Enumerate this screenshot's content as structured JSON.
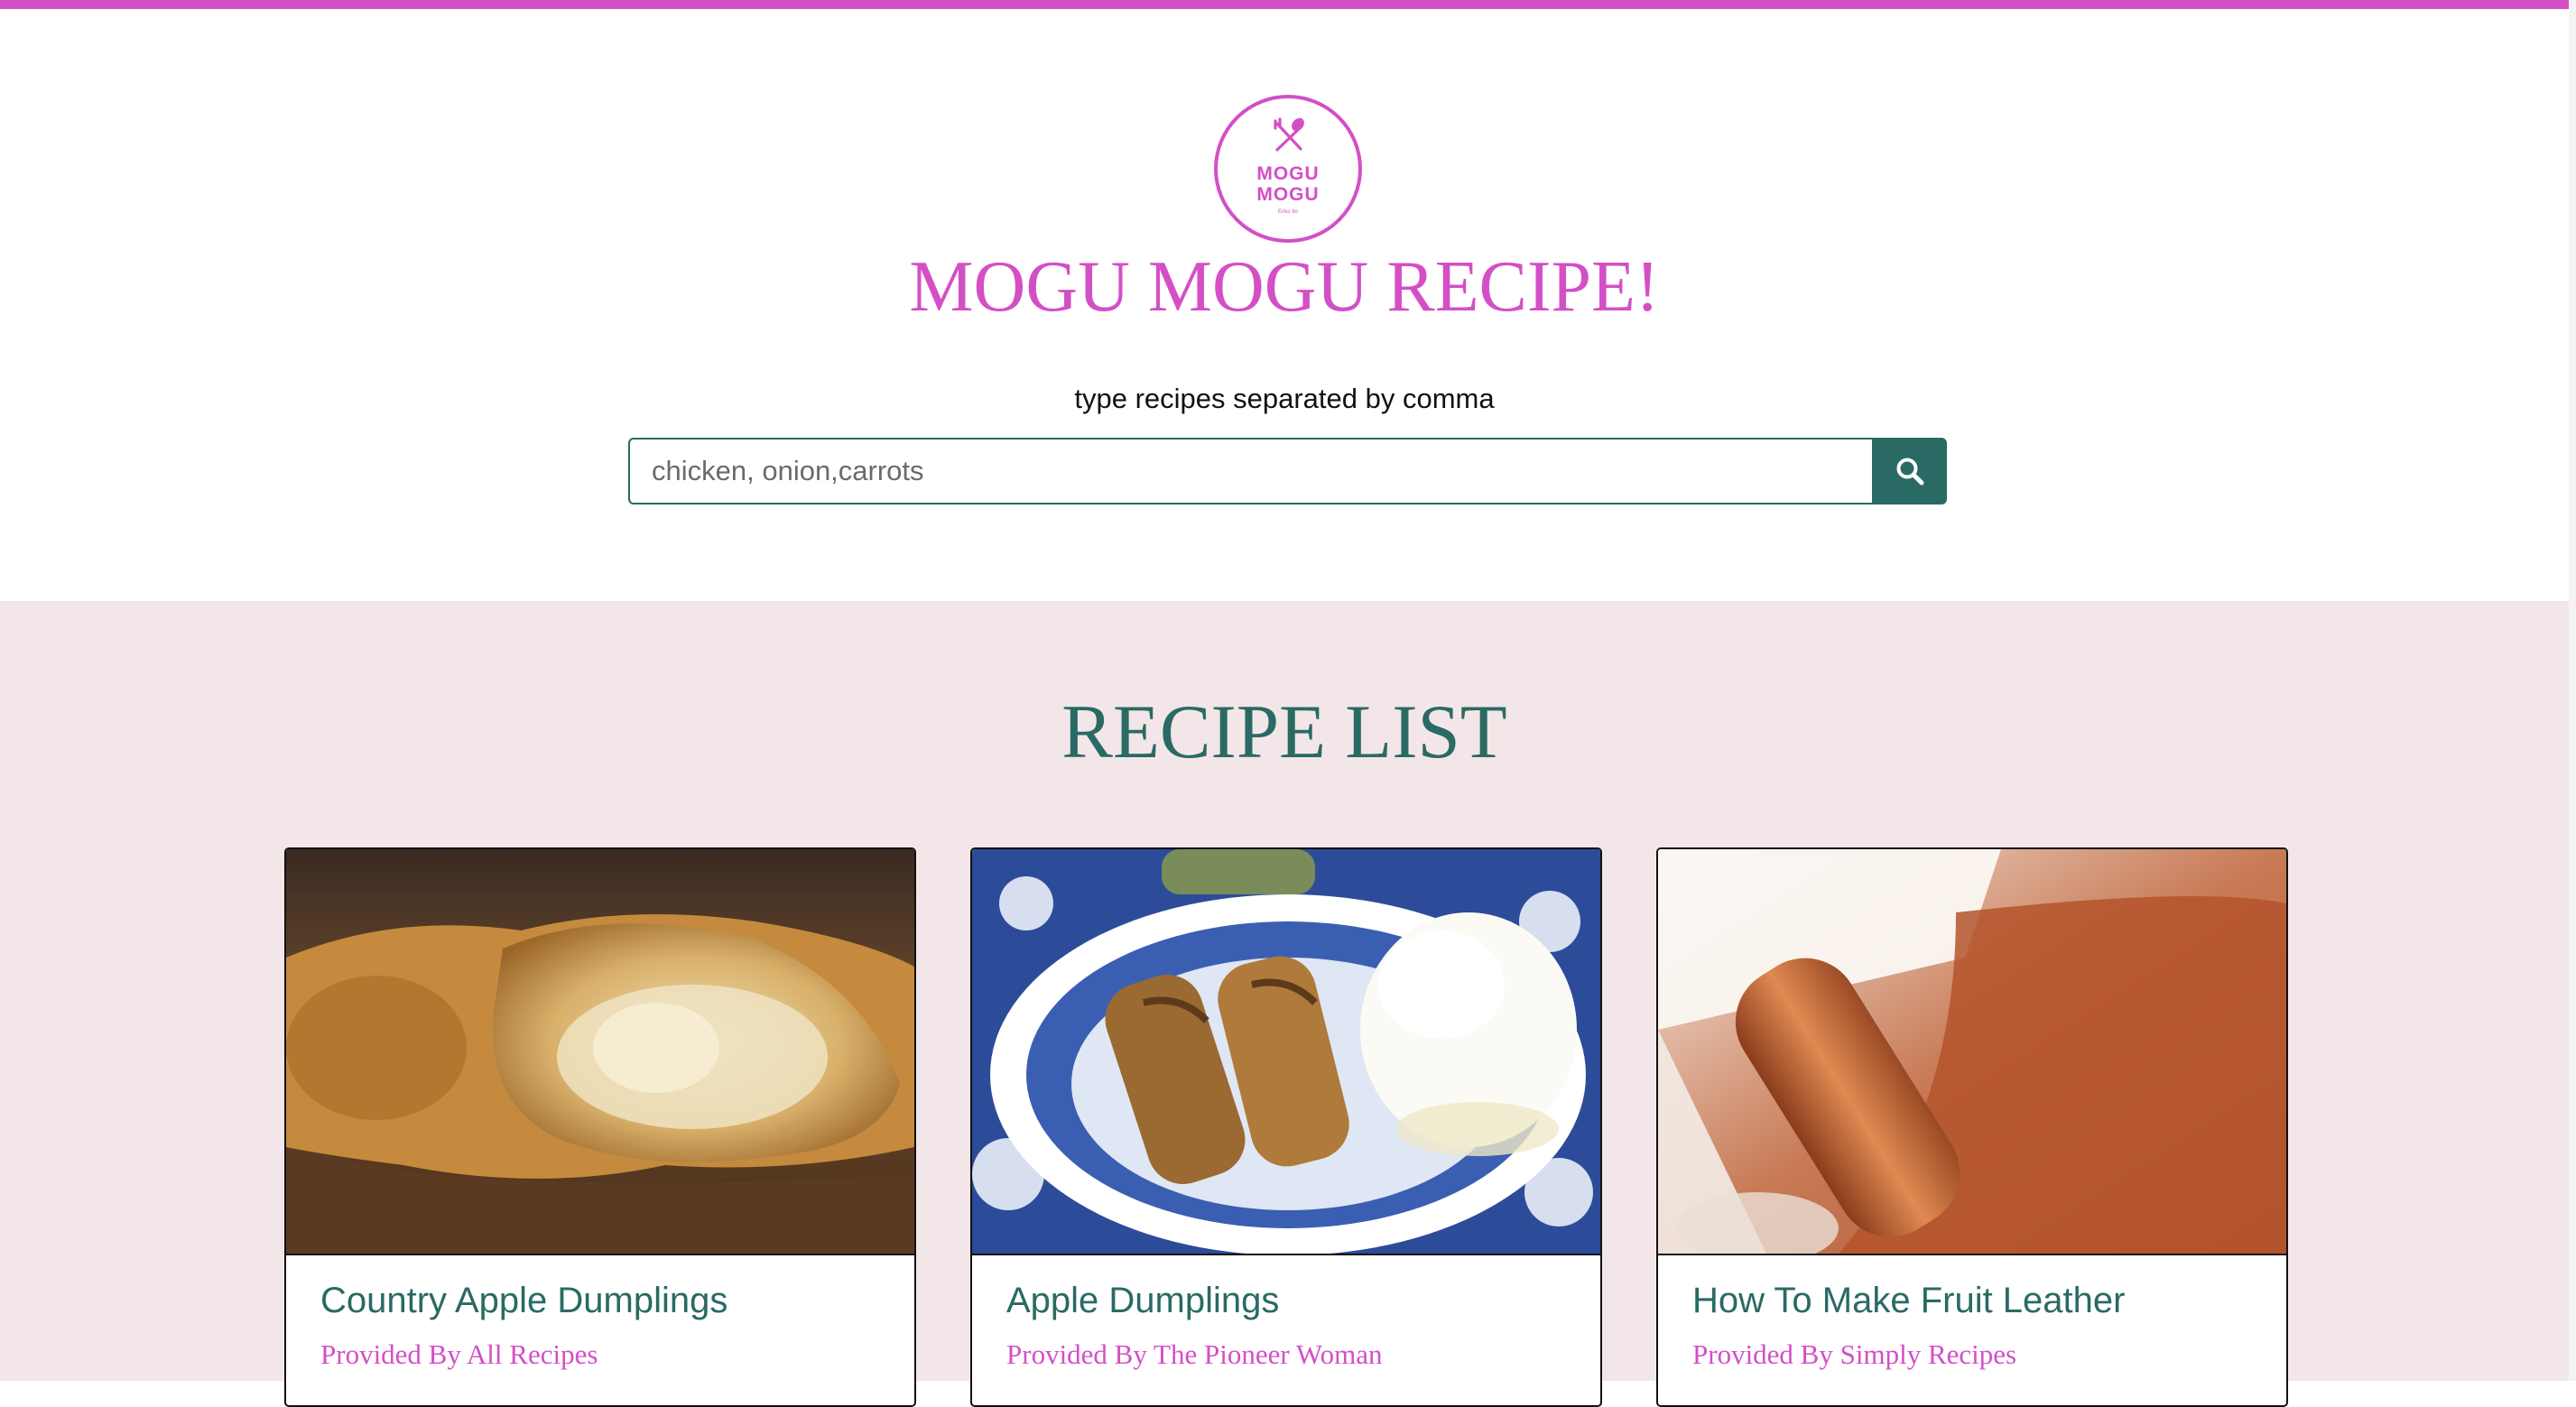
{
  "brand": {
    "logo_text_line1": "MOGU",
    "logo_text_line2": "MOGU",
    "logo_tagline": "Eriko Ito",
    "logo_icon": "fork-spoon-icon",
    "accent_color": "#d44fc6"
  },
  "header": {
    "title": "MOGU MOGU RECIPE!",
    "search_label": "type recipes separated by comma"
  },
  "search": {
    "placeholder": "chicken, onion,carrots",
    "value": "",
    "button_icon": "search-icon",
    "button_color": "#2a6a64"
  },
  "recipe_list": {
    "title": "RECIPE LIST",
    "background_color": "#f3e6e8",
    "cards": [
      {
        "title": "Country Apple Dumplings",
        "source": "Provided By All Recipes",
        "image": "apple-dumpling-closeup-photo"
      },
      {
        "title": "Apple Dumplings",
        "source": "Provided By The Pioneer Woman",
        "image": "apple-dumplings-with-ice-cream-photo"
      },
      {
        "title": "How To Make Fruit Leather",
        "source": "Provided By Simply Recipes",
        "image": "fruit-leather-roll-photo"
      }
    ]
  }
}
